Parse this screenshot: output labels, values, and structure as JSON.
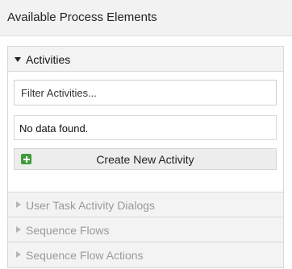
{
  "panel": {
    "title": "Available Process Elements"
  },
  "accordion": {
    "sections": [
      {
        "label": "Activities",
        "expanded": true,
        "icon": "caret-down-icon"
      },
      {
        "label": "User Task Activity Dialogs",
        "expanded": false,
        "icon": "caret-right-icon"
      },
      {
        "label": "Sequence Flows",
        "expanded": false,
        "icon": "caret-right-icon"
      },
      {
        "label": "Sequence Flow Actions",
        "expanded": false,
        "icon": "caret-right-icon"
      }
    ]
  },
  "activities": {
    "filter_placeholder": "Filter Activities...",
    "filter_value": "",
    "empty_message": "No data found.",
    "create_button_label": "Create New Activity",
    "create_button_icon": "plus-icon"
  },
  "colors": {
    "accent_green": "#3f9a3a",
    "header_bg": "#f2f2f2",
    "inactive_text": "#9a9a9a"
  }
}
